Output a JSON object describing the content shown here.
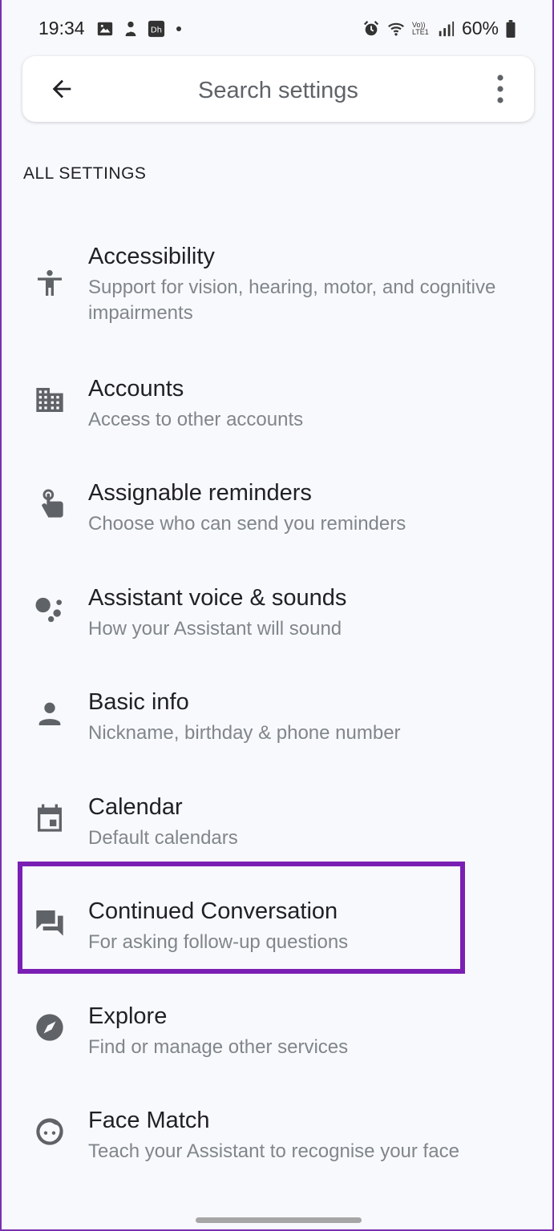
{
  "status_bar": {
    "time": "19:34",
    "battery": "60%",
    "network_label": "Vo)) LTE1",
    "left_icons": [
      "gallery-icon",
      "avatar-notification-icon",
      "hotstar-icon"
    ],
    "right_icons": [
      "alarm-icon",
      "wifi-icon",
      "volte-icon",
      "signal-icon",
      "battery-icon"
    ]
  },
  "search": {
    "placeholder": "Search settings",
    "back_icon": "arrow-back-icon",
    "more_icon": "more-vertical-icon"
  },
  "section": {
    "header": "ALL SETTINGS"
  },
  "settings": [
    {
      "icon": "accessibility-icon",
      "title": "Accessibility",
      "subtitle": "Support for vision, hearing, motor, and cognitive impairments"
    },
    {
      "icon": "accounts-building-icon",
      "title": "Accounts",
      "subtitle": "Access to other accounts"
    },
    {
      "icon": "touch-reminder-icon",
      "title": "Assignable reminders",
      "subtitle": "Choose who can send you reminders"
    },
    {
      "icon": "assistant-dots-icon",
      "title": "Assistant voice & sounds",
      "subtitle": "How your Assistant will sound"
    },
    {
      "icon": "person-icon",
      "title": "Basic info",
      "subtitle": "Nickname, birthday & phone number"
    },
    {
      "icon": "calendar-icon",
      "title": "Calendar",
      "subtitle": "Default calendars"
    },
    {
      "icon": "conversation-icon",
      "title": "Continued Conversation",
      "subtitle": "For asking follow-up questions"
    },
    {
      "icon": "compass-icon",
      "title": "Explore",
      "subtitle": "Find or manage other services"
    },
    {
      "icon": "face-icon",
      "title": "Face Match",
      "subtitle": "Teach your Assistant to recognise your face"
    }
  ],
  "colors": {
    "highlight": "#7a1fb4",
    "title_text": "#202124",
    "subtitle_text": "#80868b",
    "icon": "#5f6368"
  }
}
